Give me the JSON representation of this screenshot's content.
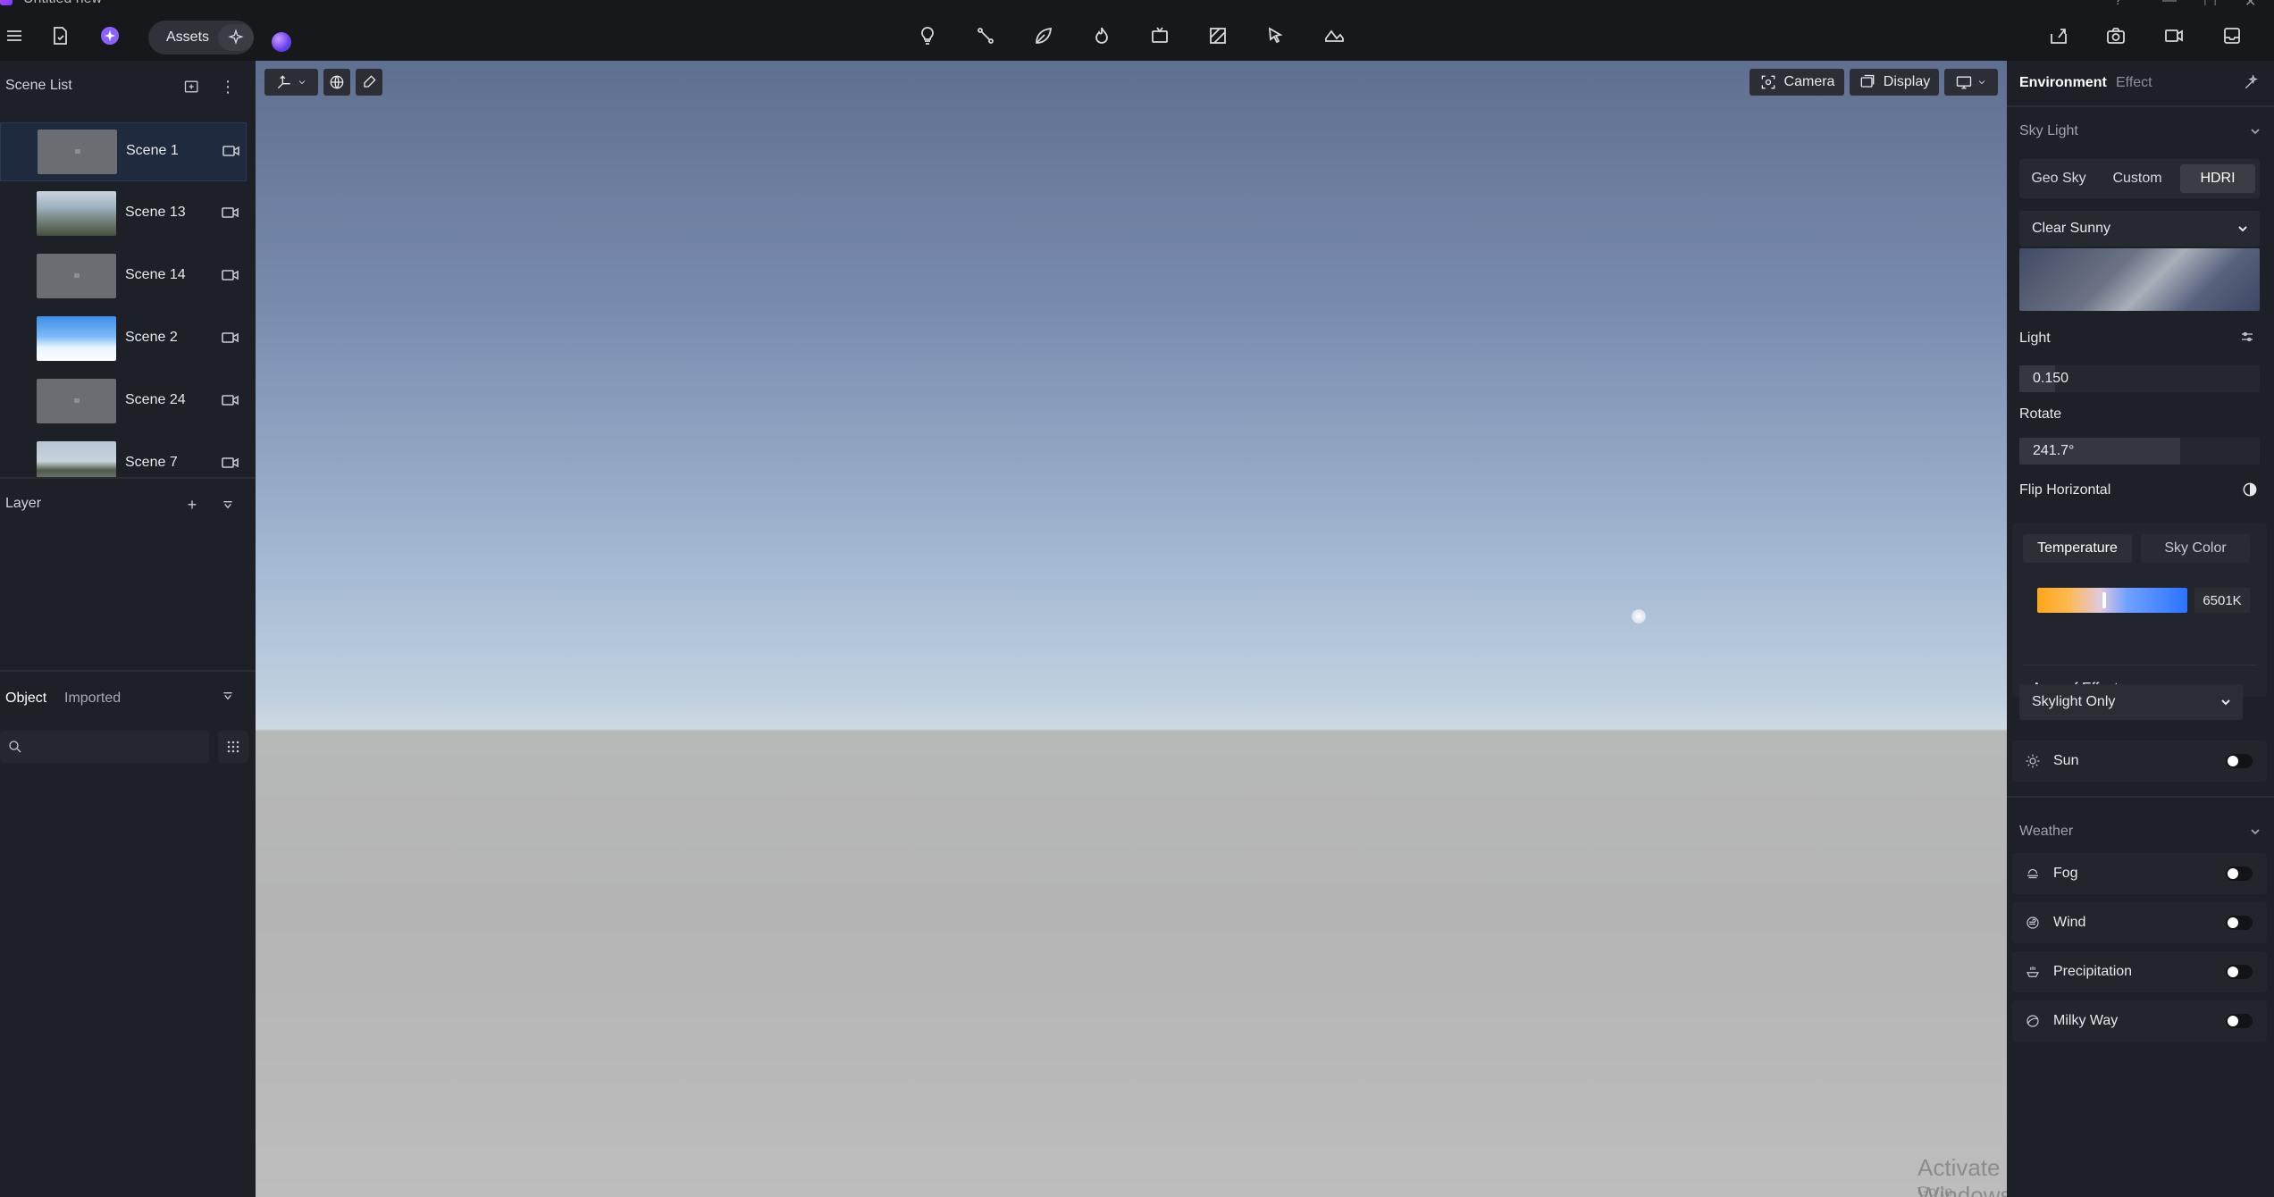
{
  "window": {
    "title": "Untitled new"
  },
  "toolbar": {
    "assets_label": "Assets"
  },
  "scene_list": {
    "title": "Scene List",
    "scenes": [
      {
        "name": "Scene 1",
        "thumb": "gray",
        "active": true
      },
      {
        "name": "Scene 13",
        "thumb": "house",
        "active": false
      },
      {
        "name": "Scene 14",
        "thumb": "gray",
        "active": false
      },
      {
        "name": "Scene 2",
        "thumb": "sky",
        "active": false
      },
      {
        "name": "Scene 24",
        "thumb": "gray",
        "active": false
      },
      {
        "name": "Scene 7",
        "thumb": "street",
        "active": false
      }
    ]
  },
  "layer": {
    "title": "Layer"
  },
  "object_tabs": {
    "object": "Object",
    "imported": "Imported"
  },
  "search": {
    "placeholder": ""
  },
  "viewport": {
    "camera_label": "Camera",
    "display_label": "Display",
    "watermark_title": "Activate Windows",
    "watermark_sub": "Go to Settings to activate Windows."
  },
  "right_panel": {
    "tabs": {
      "environment": "Environment",
      "effect": "Effect"
    },
    "sky_light": {
      "title": "Sky Light",
      "modes": [
        "Geo Sky",
        "Custom",
        "HDRI"
      ],
      "selected_mode": "HDRI",
      "preset": "Clear Sunny",
      "light_label": "Light",
      "light_value": "0.150",
      "light_fraction": 0.15,
      "rotate_label": "Rotate",
      "rotate_value": "241.7°",
      "rotate_fraction": 0.67,
      "flip_label": "Flip Horizontal",
      "temp_tab": "Temperature",
      "sky_color_tab": "Sky Color",
      "temp_value": "6501K",
      "area_label": "Area of Effect",
      "area_value": "Skylight Only",
      "sun_label": "Sun"
    },
    "weather": {
      "title": "Weather",
      "items": [
        {
          "label": "Fog",
          "icon": "fog-icon"
        },
        {
          "label": "Wind",
          "icon": "wind-icon"
        },
        {
          "label": "Precipitation",
          "icon": "precipitation-icon"
        },
        {
          "label": "Milky Way",
          "icon": "milky-way-icon"
        }
      ]
    }
  },
  "colors": {
    "accent": "#2a73ff",
    "panel": "#1d2026",
    "viewport_sky": "#7a8cae",
    "ground": "#b7b7b7"
  }
}
